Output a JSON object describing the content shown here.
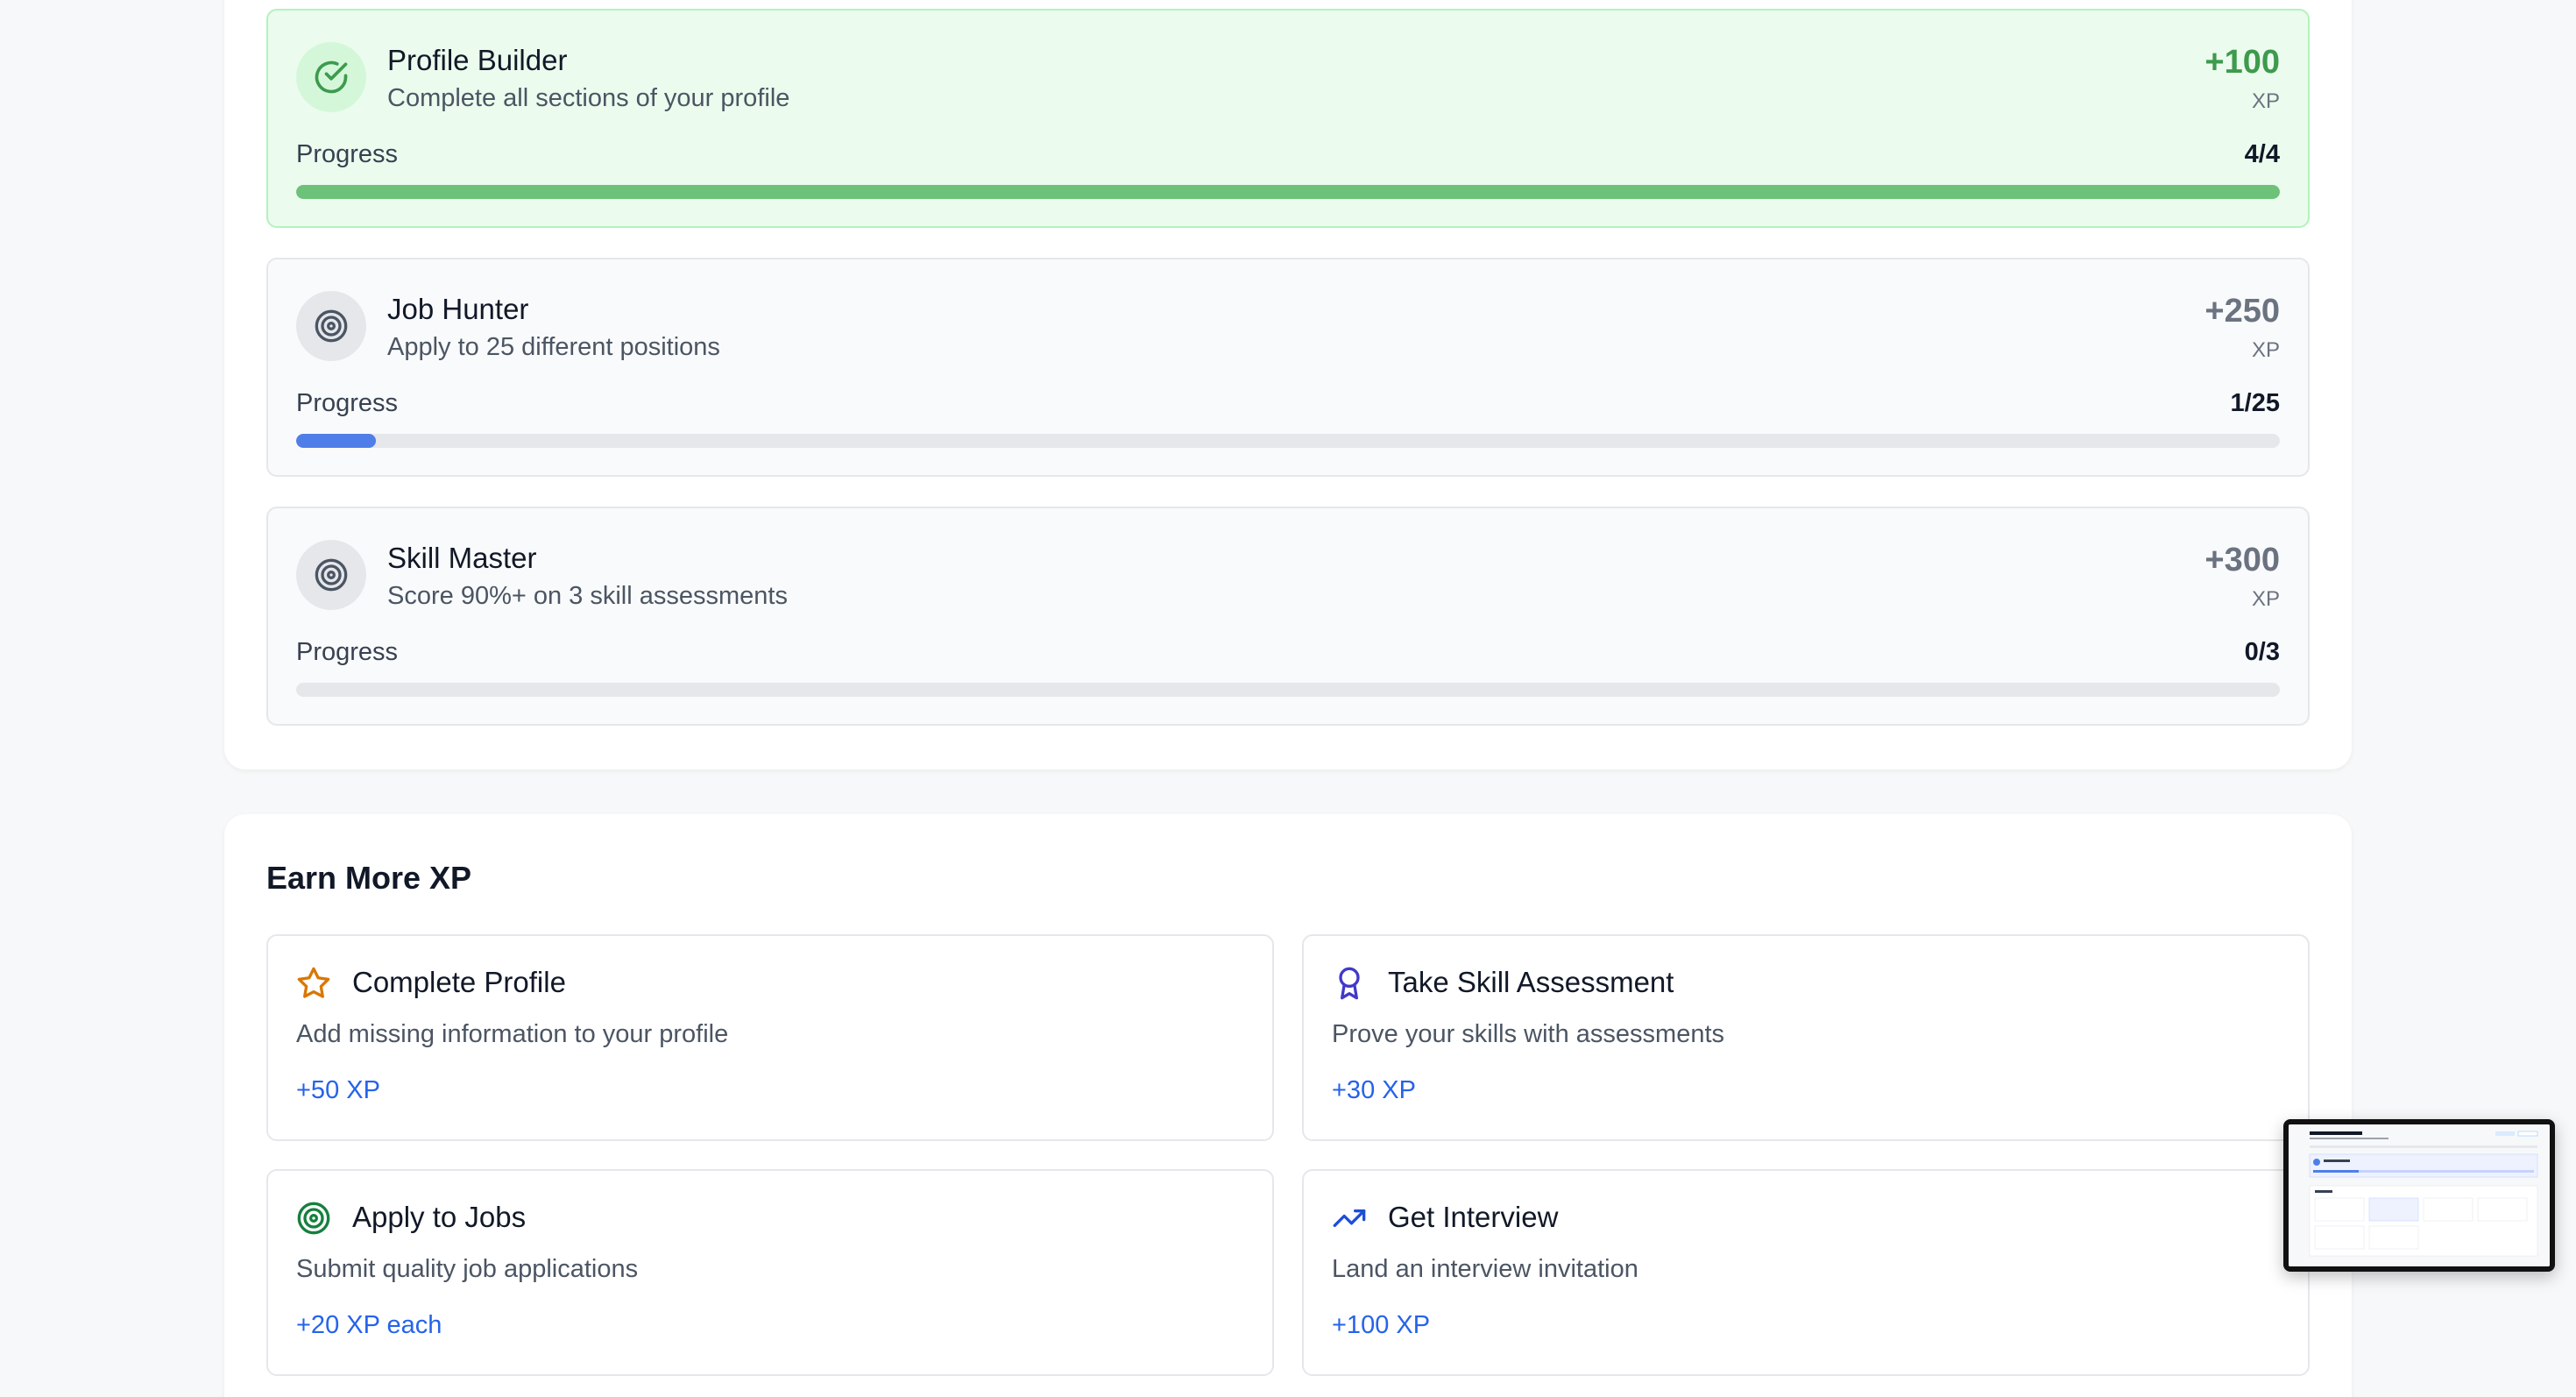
{
  "achievements": [
    {
      "title": "Profile Builder",
      "description": "Complete all sections of your profile",
      "xp": "+100",
      "xp_unit": "XP",
      "progress_label": "Progress",
      "progress_text": "4/4",
      "progress_fraction": 1.0,
      "status": "completed",
      "icon": "check-circle-icon"
    },
    {
      "title": "Job Hunter",
      "description": "Apply to 25 different positions",
      "xp": "+250",
      "xp_unit": "XP",
      "progress_label": "Progress",
      "progress_text": "1/25",
      "progress_fraction": 0.04,
      "status": "in-progress",
      "icon": "target-icon"
    },
    {
      "title": "Skill Master",
      "description": "Score 90%+ on 3 skill assessments",
      "xp": "+300",
      "xp_unit": "XP",
      "progress_label": "Progress",
      "progress_text": "0/3",
      "progress_fraction": 0.0,
      "status": "not-started",
      "icon": "target-icon"
    }
  ],
  "earn_more": {
    "title": "Earn More XP",
    "items": [
      {
        "title": "Complete Profile",
        "description": "Add missing information to your profile",
        "xp": "+50 XP",
        "icon": "star-icon",
        "icon_color": "#d97706"
      },
      {
        "title": "Take Skill Assessment",
        "description": "Prove your skills with assessments",
        "xp": "+30 XP",
        "icon": "award-icon",
        "icon_color": "#4338ca"
      },
      {
        "title": "Apply to Jobs",
        "description": "Submit quality job applications",
        "xp": "+20 XP each",
        "icon": "target-icon",
        "icon_color": "#15803d"
      },
      {
        "title": "Get Interview",
        "description": "Land an interview invitation",
        "xp": "+100 XP",
        "icon": "trending-up-icon",
        "icon_color": "#1d4ed8"
      }
    ]
  },
  "colors": {
    "completed_accent": "#3e9a4d",
    "progress_fill": "#4f7ee8",
    "link_blue": "#2563eb"
  }
}
